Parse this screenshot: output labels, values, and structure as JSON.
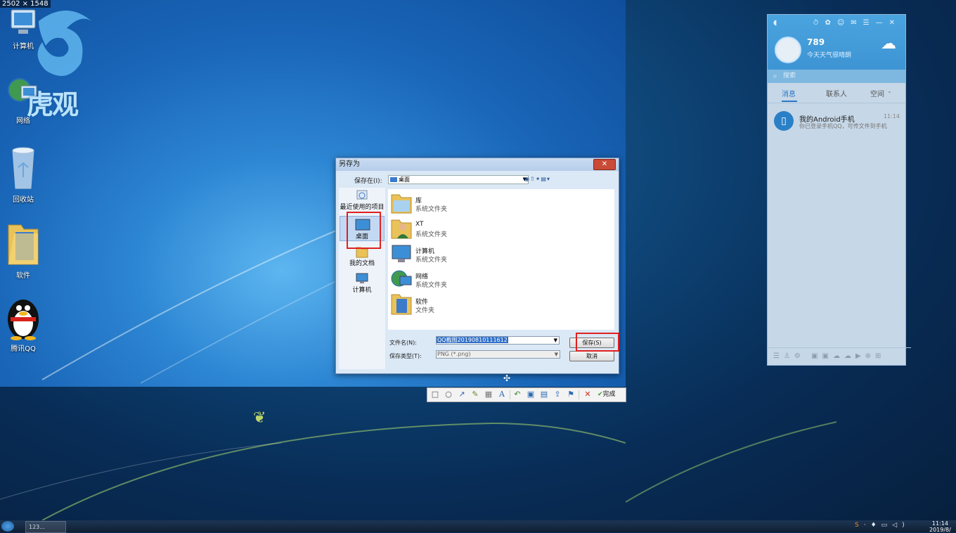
{
  "capture_size_label": "2502 × 1548",
  "desktop_icons": [
    {
      "label": "计算机",
      "icon": "computer-icon"
    },
    {
      "label": "网络",
      "icon": "network-icon"
    },
    {
      "label": "回收站",
      "icon": "recycle-bin-icon"
    },
    {
      "label": "软件",
      "icon": "folder-icon"
    },
    {
      "label": "腾讯QQ",
      "icon": "qq-penguin-icon"
    }
  ],
  "watermark": "虎观",
  "dialog": {
    "title": "另存为",
    "close_symbol": "✕",
    "save_in_label": "保存在(I):",
    "save_in_value": "桌面",
    "places": [
      {
        "label": "最近使用的项目",
        "icon": "recent-icon"
      },
      {
        "label": "桌面",
        "icon": "desktop-icon"
      },
      {
        "label": "我的文档",
        "icon": "documents-icon"
      },
      {
        "label": "计算机",
        "icon": "computer-icon"
      }
    ],
    "files": [
      {
        "name": "库",
        "desc": "系统文件夹",
        "icon": "library-icon"
      },
      {
        "name": "XT",
        "desc": "系统文件夹",
        "icon": "user-folder-icon"
      },
      {
        "name": "计算机",
        "desc": "系统文件夹",
        "icon": "computer-icon"
      },
      {
        "name": "网络",
        "desc": "系统文件夹",
        "icon": "network-icon"
      },
      {
        "name": "软件",
        "desc": "文件夹",
        "icon": "folder-icon"
      }
    ],
    "filename_label": "文件名(N):",
    "filename_value": "QQ截图20190810111612",
    "filetype_label": "保存类型(T):",
    "filetype_value": "PNG (*.png)",
    "save_button": "保存(S)",
    "cancel_button": "取消"
  },
  "capture_toolbar": {
    "tools": [
      "rectangle-icon",
      "ellipse-icon",
      "arrow-icon",
      "pen-icon",
      "mosaic-icon",
      "text-icon",
      "undo-icon",
      "save-icon",
      "pin-icon",
      "share-icon",
      "bookmark-icon"
    ],
    "cancel_symbol": "✕",
    "done_label": "完成"
  },
  "qq": {
    "qq_number": "789",
    "signature": "今天天气很晴朗",
    "search_placeholder": "搜索",
    "tabs": [
      "消息",
      "联系人",
      "空间"
    ],
    "message": {
      "title": "我的Android手机",
      "time": "11:14",
      "preview": "你已登录手机QQ，可传文件到手机"
    }
  },
  "taskbar": {
    "task_label": "123...",
    "clock_time": "11:14",
    "clock_date": "2019/8/"
  }
}
